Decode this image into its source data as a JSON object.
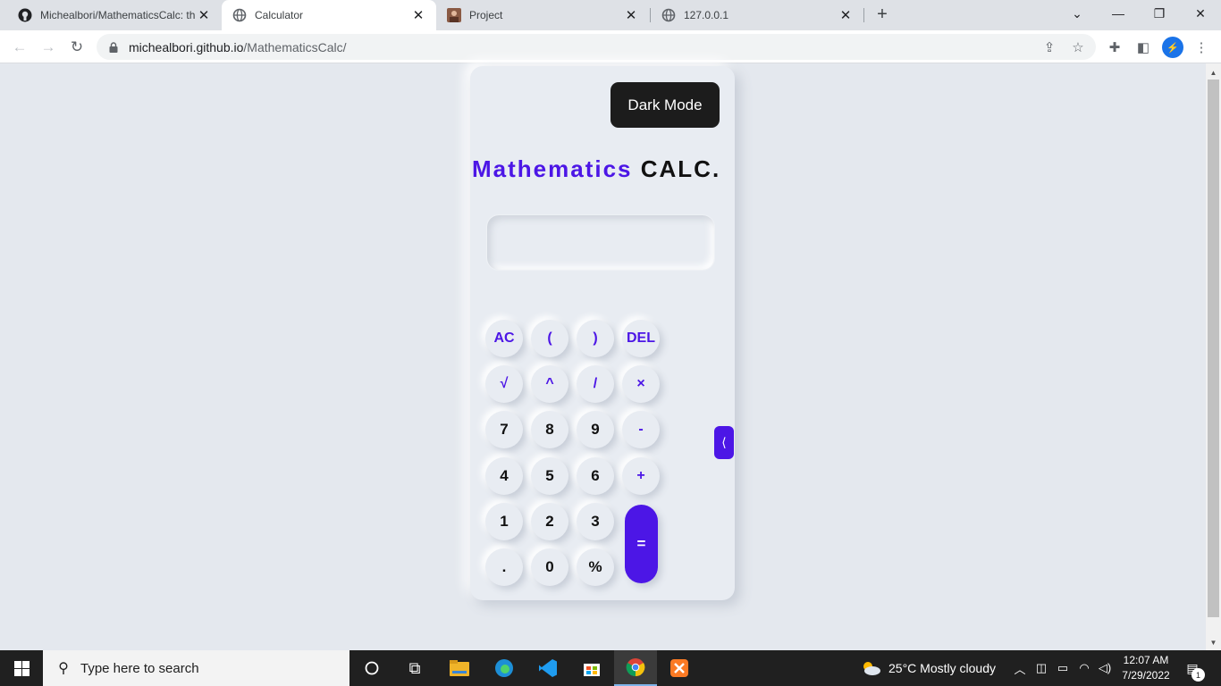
{
  "browser": {
    "tabs": [
      {
        "title": "Michealbori/MathematicsCalc: th",
        "favicon": "github-icon"
      },
      {
        "title": "Calculator",
        "favicon": "globe-icon"
      },
      {
        "title": "Project",
        "favicon": "image-favicon"
      },
      {
        "title": "127.0.0.1",
        "favicon": "globe-icon"
      }
    ],
    "active_tab": 1,
    "url_host": "michealbori.github.io",
    "url_path": "/MathematicsCalc/"
  },
  "calculator": {
    "dark_mode_label": "Dark Mode",
    "title_part1": "Mathematics",
    "title_part2": "CALC.",
    "display_value": "",
    "keys": {
      "ac": "AC",
      "lparen": "(",
      "rparen": ")",
      "del": "DEL",
      "sqrt": "√",
      "pow": "^",
      "div": "/",
      "mul": "×",
      "k7": "7",
      "k8": "8",
      "k9": "9",
      "minus": "-",
      "k4": "4",
      "k5": "5",
      "k6": "6",
      "plus": "+",
      "k1": "1",
      "k2": "2",
      "k3": "3",
      "eq": "=",
      "dot": ".",
      "k0": "0",
      "pct": "%"
    },
    "side_toggle": "⟨",
    "accent_color": "#4c16e6"
  },
  "taskbar": {
    "search_placeholder": "Type here to search",
    "weather": "25°C  Mostly cloudy",
    "time": "12:07 AM",
    "date": "7/29/2022",
    "notification_count": "1"
  }
}
